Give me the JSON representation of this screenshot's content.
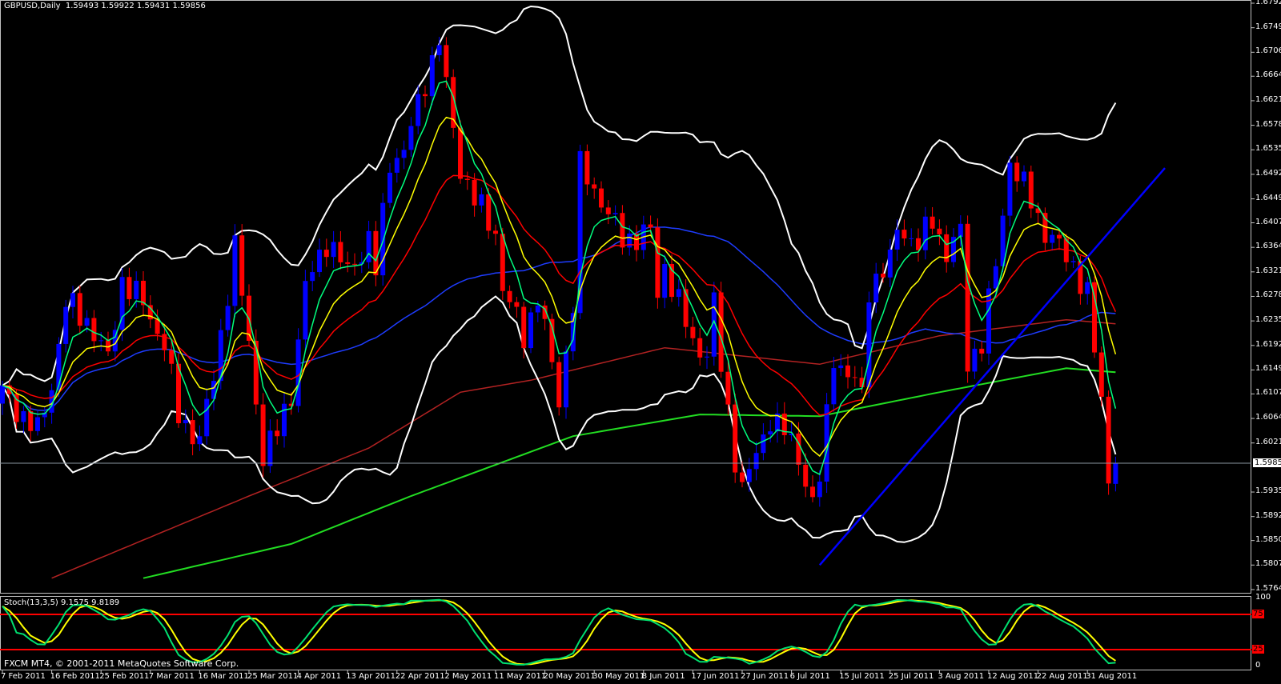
{
  "header": {
    "symbol_timeframe": "GBPUSD,Daily",
    "ohlc": "1.59493 1.59922 1.59431 1.59856"
  },
  "stoch": {
    "label": "Stoch(13,3,5) 9.1575 9.8189",
    "levels": [
      "100",
      "75",
      "25",
      "0"
    ]
  },
  "copyright": "FXCM MT4, © 2001-2011 MetaQuotes Software Corp.",
  "current_price": "1.59856",
  "price_axis": [
    "1.67920",
    "1.67490",
    "1.67060",
    "1.66640",
    "1.66210",
    "1.65780",
    "1.65350",
    "1.64920",
    "1.64490",
    "1.64070",
    "1.63640",
    "1.63210",
    "1.62780",
    "1.62350",
    "1.61920",
    "1.61490",
    "1.61070",
    "1.60640",
    "1.60210",
    "1.59350",
    "1.58920",
    "1.58500",
    "1.58070",
    "1.57640"
  ],
  "date_axis": [
    "7 Feb 2011",
    "16 Feb 2011",
    "25 Feb 2011",
    "7 Mar 2011",
    "16 Mar 2011",
    "25 Mar 2011",
    "4 Apr 2011",
    "13 Apr 2011",
    "22 Apr 2011",
    "2 May 2011",
    "11 May 2011",
    "20 May 2011",
    "30 May 2011",
    "8 Jun 2011",
    "17 Jun 2011",
    "27 Jun 2011",
    "6 Jul 2011",
    "15 Jul 2011",
    "25 Jul 2011",
    "3 Aug 2011",
    "12 Aug 2011",
    "22 Aug 2011",
    "31 Aug 2011"
  ],
  "colors": {
    "bull": "#0000ff",
    "bear": "#ff0000",
    "bands": "#ffffff",
    "ema_fast": "#00ff7f",
    "ema_mid": "#ffff00",
    "ema_slow": "#ff0000",
    "ma_blue": "#1e3cff",
    "ma_long1": "#b22222",
    "ma_long2": "#22dd22",
    "trendline": "#0000ff",
    "stoch_main": "#00e070",
    "stoch_signal": "#ffff00"
  },
  "chart_data": {
    "type": "candlestick",
    "title": "GBPUSD,Daily",
    "ylim": [
      1.5764,
      1.6792
    ],
    "close_keypoints": [
      [
        0,
        1.611
      ],
      [
        5,
        1.604
      ],
      [
        7,
        1.6124
      ],
      [
        9,
        1.6265
      ],
      [
        12,
        1.6237
      ],
      [
        15,
        1.6166
      ],
      [
        17,
        1.6307
      ],
      [
        20,
        1.6265
      ],
      [
        23,
        1.6195
      ],
      [
        25,
        1.6068
      ],
      [
        28,
        1.6026
      ],
      [
        30,
        1.6138
      ],
      [
        33,
        1.6363
      ],
      [
        35,
        1.6195
      ],
      [
        37,
        1.5998
      ],
      [
        39,
        1.604
      ],
      [
        41,
        1.611
      ],
      [
        43,
        1.6293
      ],
      [
        46,
        1.6377
      ],
      [
        49,
        1.6321
      ],
      [
        52,
        1.6377
      ],
      [
        53,
        1.6321
      ],
      [
        55,
        1.6517
      ],
      [
        57,
        1.6531
      ],
      [
        60,
        1.6657
      ],
      [
        62,
        1.6727
      ],
      [
        63,
        1.6643
      ],
      [
        65,
        1.6503
      ],
      [
        67,
        1.6447
      ],
      [
        70,
        1.6391
      ],
      [
        71,
        1.6293
      ],
      [
        74,
        1.6209
      ],
      [
        76,
        1.6279
      ],
      [
        79,
        1.6096
      ],
      [
        81,
        1.6265
      ],
      [
        82,
        1.6503
      ],
      [
        85,
        1.6447
      ],
      [
        88,
        1.6377
      ],
      [
        92,
        1.6391
      ],
      [
        93,
        1.6279
      ],
      [
        94,
        1.6335
      ],
      [
        96,
        1.6265
      ],
      [
        98,
        1.6195
      ],
      [
        100,
        1.618
      ],
      [
        101,
        1.6265
      ],
      [
        102,
        1.6152
      ],
      [
        104,
        1.5998
      ],
      [
        105,
        1.5942
      ],
      [
        107,
        1.5998
      ],
      [
        109,
        1.6068
      ],
      [
        111,
        1.604
      ],
      [
        113,
        1.5998
      ],
      [
        115,
        1.5914
      ],
      [
        116,
        1.5956
      ],
      [
        118,
        1.618
      ],
      [
        119,
        1.6152
      ],
      [
        122,
        1.611
      ],
      [
        123,
        1.6293
      ],
      [
        126,
        1.6335
      ],
      [
        127,
        1.6405
      ],
      [
        130,
        1.6363
      ],
      [
        132,
        1.6419
      ],
      [
        134,
        1.6349
      ],
      [
        136,
        1.6391
      ],
      [
        137,
        1.6166
      ],
      [
        139,
        1.6195
      ],
      [
        141,
        1.6335
      ],
      [
        143,
        1.6517
      ],
      [
        144,
        1.6489
      ],
      [
        146,
        1.6447
      ],
      [
        148,
        1.6391
      ],
      [
        150,
        1.6363
      ],
      [
        152,
        1.6335
      ],
      [
        154,
        1.6279
      ],
      [
        155,
        1.618
      ],
      [
        156,
        1.61
      ],
      [
        157,
        1.595
      ],
      [
        158,
        1.5986
      ]
    ],
    "ma_long1_keypoints": [
      [
        7,
        1.5784
      ],
      [
        35,
        1.5928
      ],
      [
        52,
        1.6012
      ],
      [
        65,
        1.611
      ],
      [
        75,
        1.6131
      ],
      [
        94,
        1.6188
      ],
      [
        116,
        1.6159
      ],
      [
        133,
        1.6209
      ],
      [
        151,
        1.6237
      ],
      [
        158,
        1.623
      ]
    ],
    "ma_long2_keypoints": [
      [
        20,
        1.5784
      ],
      [
        41,
        1.5844
      ],
      [
        58,
        1.5928
      ],
      [
        81,
        1.6033
      ],
      [
        99,
        1.6071
      ],
      [
        116,
        1.6068
      ],
      [
        133,
        1.611
      ],
      [
        151,
        1.6152
      ],
      [
        158,
        1.6145
      ]
    ],
    "trendline": [
      [
        116,
        1.5807
      ],
      [
        165,
        1.6503
      ]
    ],
    "stoch_params": [
      13,
      3,
      5
    ],
    "stoch_levels": [
      75,
      25
    ]
  }
}
